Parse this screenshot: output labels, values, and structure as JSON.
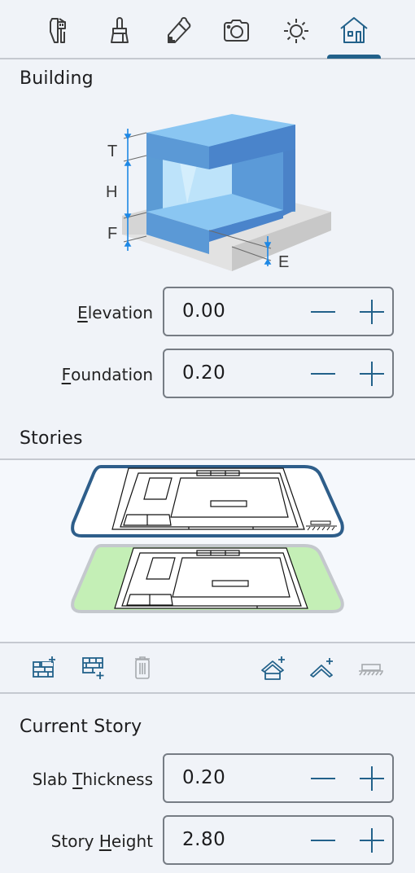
{
  "toolbar": {
    "tabs": [
      {
        "name": "measure",
        "icon": "caliper-ruler-icon",
        "active": false
      },
      {
        "name": "paint",
        "icon": "brush-icon",
        "active": false
      },
      {
        "name": "edit",
        "icon": "pencil-icon",
        "active": false
      },
      {
        "name": "camera",
        "icon": "camera-icon",
        "active": false
      },
      {
        "name": "lighting",
        "icon": "sun-icon",
        "active": false
      },
      {
        "name": "building",
        "icon": "house-icon",
        "active": true
      }
    ]
  },
  "building": {
    "title": "Building",
    "diagram_labels": {
      "t": "T",
      "h": "H",
      "f": "F",
      "e": "E"
    },
    "elevation": {
      "label_mnemonic": "E",
      "label_rest": "levation",
      "value": "0.00"
    },
    "foundation": {
      "label_mnemonic": "F",
      "label_rest": "oundation",
      "value": "0.20"
    }
  },
  "stories": {
    "title": "Stories",
    "items": [
      {
        "name": "upper-story",
        "selected": true
      },
      {
        "name": "ground-story",
        "selected": false
      }
    ],
    "actions": [
      {
        "name": "add-story-above",
        "icon": "bricks-plus-icon",
        "enabled": true
      },
      {
        "name": "add-story-below",
        "icon": "bricks-plus-below-icon",
        "enabled": true
      },
      {
        "name": "delete-story",
        "icon": "trash-icon",
        "enabled": false
      },
      {
        "name": "add-roof",
        "icon": "house-roof-plus-icon",
        "enabled": true
      },
      {
        "name": "add-roof-only",
        "icon": "roof-plus-icon",
        "enabled": true
      },
      {
        "name": "foundation-slab",
        "icon": "ground-slab-icon",
        "enabled": false
      }
    ]
  },
  "current_story": {
    "title": "Current Story",
    "slab_thickness": {
      "label_pre": "Slab ",
      "label_mnemonic": "T",
      "label_rest": "hickness",
      "value": "0.20"
    },
    "story_height": {
      "label_pre": "Story ",
      "label_mnemonic": "H",
      "label_rest": "eight",
      "value": "2.80"
    }
  },
  "colors": {
    "accent": "#22618a",
    "icon": "#3c3c3c",
    "disabled": "#a6a9ad",
    "selected_story_border": "#2e5e8a",
    "ground_story_fill": "#c4efb6"
  }
}
